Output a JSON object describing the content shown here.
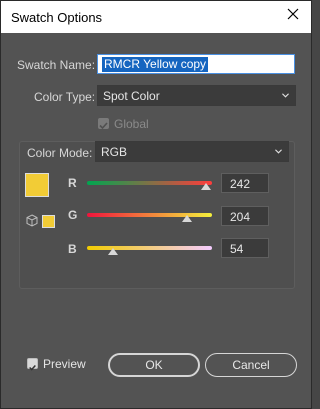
{
  "window": {
    "title": "Swatch Options"
  },
  "swatch_name": {
    "label": "Swatch Name:",
    "value": "RMCR Yellow copy"
  },
  "color_type": {
    "label": "Color Type:",
    "value": "Spot Color"
  },
  "global": {
    "label": "Global",
    "checked": true,
    "disabled": true
  },
  "color_mode": {
    "label": "Color Mode:",
    "value": "RGB"
  },
  "sliders": [
    {
      "channel": "R",
      "value": "242",
      "max": 255,
      "track_colors": [
        "#00a650",
        "#ff3c3c"
      ]
    },
    {
      "channel": "G",
      "value": "204",
      "max": 255,
      "track_colors": [
        "#f0143c",
        "#f4f03c"
      ]
    },
    {
      "channel": "B",
      "value": "54",
      "max": 255,
      "track_colors": [
        "#f2cc00",
        "#f4ccff"
      ]
    }
  ],
  "swatch_color": "#F2CC36",
  "preview": {
    "label": "Preview",
    "checked": true
  },
  "buttons": {
    "ok": "OK",
    "cancel": "Cancel"
  },
  "colors": {
    "accent": "#1565c0",
    "dialog_bg": "#535353"
  }
}
